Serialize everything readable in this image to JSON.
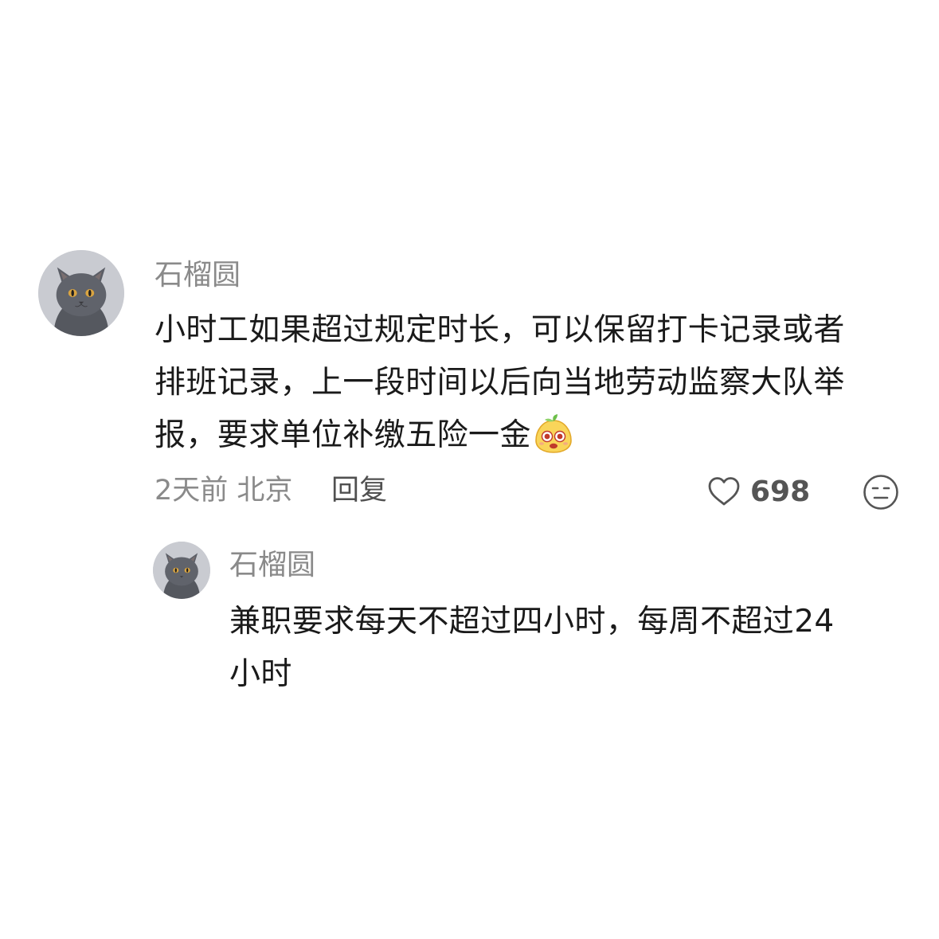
{
  "comment": {
    "username": "石榴圆",
    "avatar_icon": "cat-avatar",
    "text_lines": [
      "小时工如果超过规定时长，可以保留打卡记录或者",
      "排班记录，上一段时间以后向当地劳动监察大队举",
      "报，要求单位补缴五险一金"
    ],
    "emoji_icon": "mango-face-emoji",
    "time_location": "2天前 北京",
    "reply_label": "回复",
    "like_icon": "heart-icon",
    "like_count": "698",
    "dislike_icon": "meh-face-icon"
  },
  "reply": {
    "username": "石榴圆",
    "avatar_icon": "cat-avatar",
    "text_lines": [
      "兼职要求每天不超过四小时，每周不超过24",
      "小时"
    ]
  },
  "colors": {
    "background": "#ffffff",
    "username": "#8a8a8a",
    "body_text": "#1a1a1a",
    "meta_text": "#8a8a8a",
    "reply_link": "#505050",
    "icon_stroke": "#555555"
  }
}
